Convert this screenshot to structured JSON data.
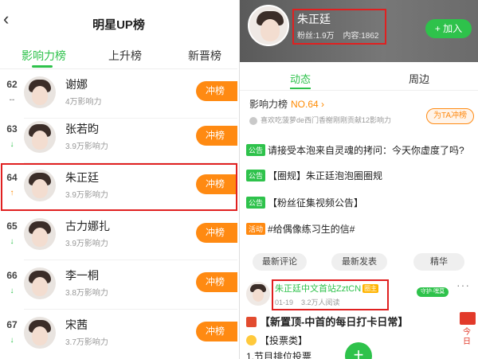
{
  "left": {
    "title": "明星UP榜",
    "back_glyph": "‹",
    "tabs": [
      "影响力榜",
      "上升榜",
      "新晋榜"
    ],
    "rows": [
      {
        "rank": "62",
        "trend": "flat",
        "trend_glyph": "--",
        "name": "谢娜",
        "influence": "4万影响力",
        "action": "冲榜"
      },
      {
        "rank": "63",
        "trend": "down",
        "trend_glyph": "↓",
        "name": "张若昀",
        "influence": "3.9万影响力",
        "action": "冲榜"
      },
      {
        "rank": "64",
        "trend": "up",
        "trend_glyph": "↑",
        "name": "朱正廷",
        "influence": "3.9万影响力",
        "action": "冲榜"
      },
      {
        "rank": "65",
        "trend": "down",
        "trend_glyph": "↓",
        "name": "古力娜扎",
        "influence": "3.9万影响力",
        "action": "冲榜"
      },
      {
        "rank": "66",
        "trend": "down",
        "trend_glyph": "↓",
        "name": "李一桐",
        "influence": "3.8万影响力",
        "action": "冲榜"
      },
      {
        "rank": "67",
        "trend": "down",
        "trend_glyph": "↓",
        "name": "宋茜",
        "influence": "3.7万影响力",
        "action": "冲榜"
      }
    ]
  },
  "right": {
    "star_name": "朱正廷",
    "fans": "粉丝:1.9万",
    "content": "内容:1862",
    "join": "+ 加入",
    "tabs": [
      "动态",
      "周边"
    ],
    "rank_label": "影响力榜",
    "rank_no": "NO.64",
    "rank_arrow": "›",
    "contrib": "喜欢吃菠萝de西门香榭刚刚贡献12影响力",
    "chong_ta": "为TA冲榜",
    "posts": [
      {
        "tag": "公告",
        "color": "g",
        "text": "请接受本泡来自灵魂的拷问：今天你虚度了吗?"
      },
      {
        "tag": "公告",
        "color": "g",
        "text": "【圈规】朱正廷泡泡圈圈规"
      },
      {
        "tag": "公告",
        "color": "g",
        "text": "【粉丝征集视频公告】"
      },
      {
        "tag": "活动",
        "color": "o",
        "text": "#给偶像练习生的信#"
      }
    ],
    "filters": [
      "最新评论",
      "最新发表",
      "精华"
    ],
    "user": {
      "name": "朱正廷中文首站ZztCN",
      "tag": "圈主",
      "date": "01-19",
      "reads": "3.2万人阅读",
      "badge": "守护·嘿莫"
    },
    "more": "···",
    "pinned": "【新置顶-中首的每日打卡日常】",
    "vote_title": "【投票类】",
    "vote_line": "1.节目排位投票",
    "fab": "+",
    "gift_text": "今日"
  }
}
